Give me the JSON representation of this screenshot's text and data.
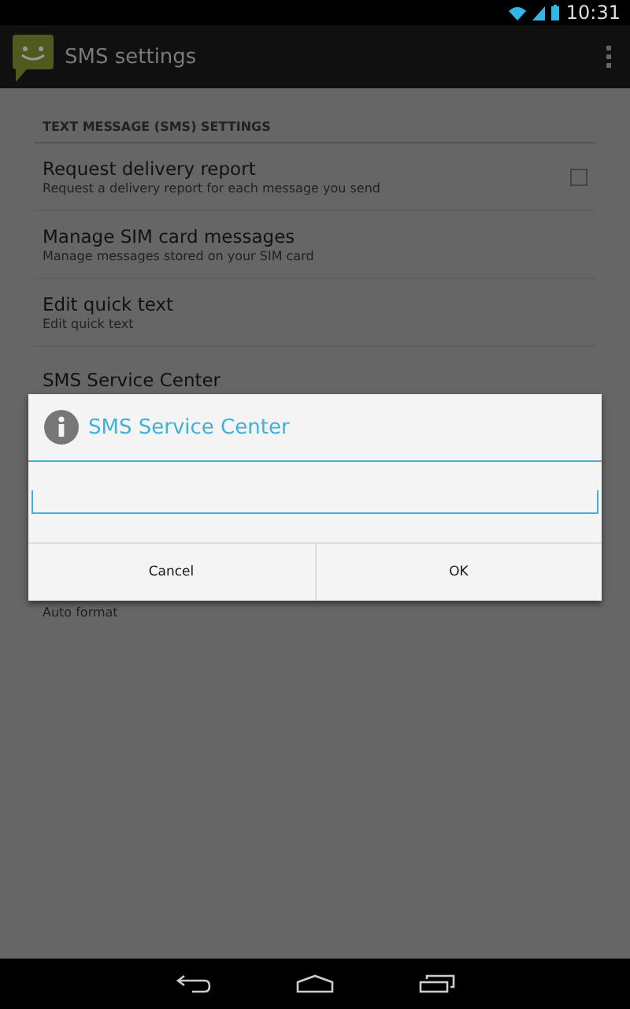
{
  "status_bar": {
    "time": "10:31"
  },
  "action_bar": {
    "title": "SMS settings"
  },
  "section": {
    "header": "TEXT MESSAGE (SMS) SETTINGS",
    "items": [
      {
        "kind": "checkbox",
        "title": "Request delivery report",
        "summary": "Request a delivery report for each message you send",
        "checked": false
      },
      {
        "kind": "plain",
        "title": "Manage SIM card messages",
        "summary": "Manage messages stored on your SIM card"
      },
      {
        "kind": "plain",
        "title": "Edit quick text",
        "summary": "Edit quick text"
      },
      {
        "kind": "plain",
        "title": "SMS Service Center"
      },
      {
        "kind": "plain",
        "summary": "Auto format"
      }
    ]
  },
  "dialog": {
    "title": "SMS Service Center",
    "buttons": [
      "Cancel",
      "OK"
    ]
  }
}
